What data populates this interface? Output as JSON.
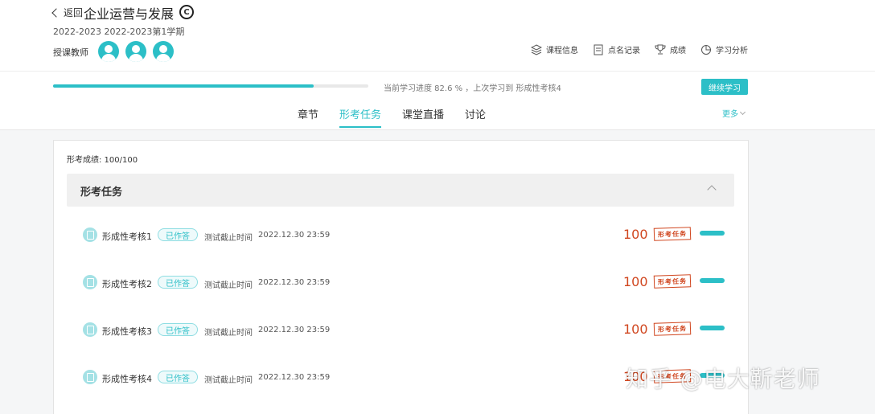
{
  "header": {
    "back_label": "返回",
    "course_title": "企业运营与发展",
    "copyright_symbol": "C",
    "term": "2022-2023 2022-2023第1学期",
    "teacher_label": "授课教师",
    "actions": [
      {
        "label": "课程信息",
        "icon": "layers-icon"
      },
      {
        "label": "点名记录",
        "icon": "document-icon"
      },
      {
        "label": "成绩",
        "icon": "trophy-icon"
      },
      {
        "label": "学习分析",
        "icon": "pie-chart-icon"
      }
    ]
  },
  "progress": {
    "percent": 82.6,
    "text": "当前学习进度 82.6 % ，上次学习到 形成性考核4",
    "continue_label": "继续学习"
  },
  "tabs": [
    {
      "label": "章节",
      "active": false
    },
    {
      "label": "形考任务",
      "active": true
    },
    {
      "label": "课堂直播",
      "active": false
    },
    {
      "label": "讨论",
      "active": false
    }
  ],
  "more_label": "更多",
  "panel": {
    "score_line": "形考成绩: 100/100",
    "group_title": "形考任务",
    "tasks": [
      {
        "name": "形成性考核1",
        "badge": "已作答",
        "deadline_label": "测试截止时间",
        "deadline": "2022.12.30 23:59",
        "score": "100",
        "stamp": "形考任务"
      },
      {
        "name": "形成性考核2",
        "badge": "已作答",
        "deadline_label": "测试截止时间",
        "deadline": "2022.12.30 23:59",
        "score": "100",
        "stamp": "形考任务"
      },
      {
        "name": "形成性考核3",
        "badge": "已作答",
        "deadline_label": "测试截止时间",
        "deadline": "2022.12.30 23:59",
        "score": "100",
        "stamp": "形考任务"
      },
      {
        "name": "形成性考核4",
        "badge": "已作答",
        "deadline_label": "测试截止时间",
        "deadline": "2022.12.30 23:59",
        "score": "100",
        "stamp": "形考任务"
      }
    ]
  },
  "watermark": "知乎 @电大靳老师",
  "colors": {
    "accent": "#2cbfc7",
    "score": "#d0461f"
  }
}
